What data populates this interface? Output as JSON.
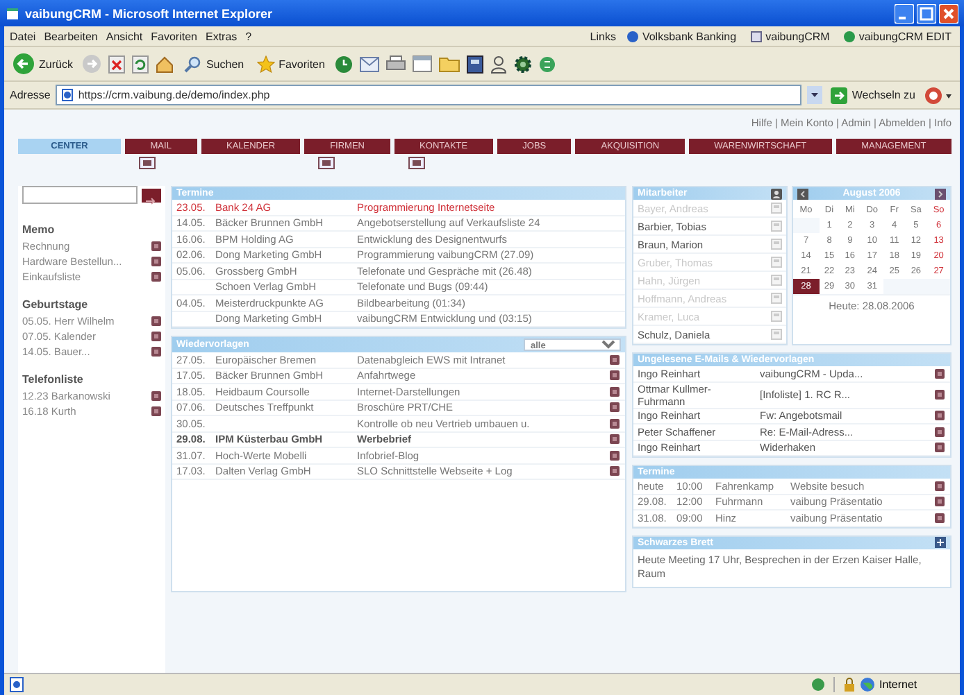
{
  "window": {
    "title": "vaibungCRM - Microsoft Internet Explorer"
  },
  "menu": [
    "Datei",
    "Bearbeiten",
    "Ansicht",
    "Favoriten",
    "Extras",
    "?"
  ],
  "links_bar": {
    "label": "Links",
    "items": [
      "Volksbank Banking",
      "vaibungCRM",
      "vaibungCRM EDIT"
    ]
  },
  "toolbar": {
    "back": "Zurück",
    "search": "Suchen",
    "favorites": "Favoriten"
  },
  "address_bar": {
    "label": "Adresse",
    "value": "https://crm.vaibung.de/demo/index.php",
    "go": "Wechseln zu"
  },
  "top_links": "Hilfe | Mein Konto | Admin | Abmelden | Info",
  "tabs": [
    {
      "label": "CENTER",
      "selected": true,
      "badge": false
    },
    {
      "label": "MAIL",
      "selected": false,
      "badge": true
    },
    {
      "label": "KALENDER",
      "selected": false,
      "badge": false
    },
    {
      "label": "FIRMEN",
      "selected": false,
      "badge": true
    },
    {
      "label": "KONTAKTE",
      "selected": false,
      "badge": true
    },
    {
      "label": "JOBS",
      "selected": false,
      "badge": false
    },
    {
      "label": "AKQUISITION",
      "selected": false,
      "badge": false
    },
    {
      "label": "WARENWIRTSCHAFT",
      "selected": false,
      "badge": false
    },
    {
      "label": "MANAGEMENT",
      "selected": false,
      "badge": false
    }
  ],
  "sidebar": {
    "sections": [
      {
        "title": "Memo",
        "items": [
          "Rechnung",
          "Hardware Bestellun...",
          "Einkaufsliste"
        ]
      },
      {
        "title": "Geburtstage",
        "items": [
          "05.05. Herr Wilhelm",
          "07.05. Kalender",
          "14.05. Bauer..."
        ]
      },
      {
        "title": "Telefonliste",
        "items": [
          "12.23 Barkanowski",
          "16.18 Kurth"
        ]
      }
    ]
  },
  "appointments": {
    "title": "Termine",
    "rows": [
      {
        "date": "23.05.",
        "company": "Bank 24 AG",
        "subject": "Programmierung Internetseite",
        "highlight": true
      },
      {
        "date": "14.05.",
        "company": "Bäcker Brunnen GmbH",
        "subject": "Angebotserstellung auf Verkaufsliste 24",
        "highlight": false
      },
      {
        "date": "16.06.",
        "company": "BPM Holding AG",
        "subject": "Entwicklung des Designentwurfs",
        "highlight": false
      },
      {
        "date": "02.06.",
        "company": "Dong Marketing GmbH",
        "subject": "Programmierung vaibungCRM (27.09)",
        "highlight": false
      },
      {
        "date": "05.06.",
        "company": "Grossberg GmbH",
        "subject": "Telefonate und Gespräche mit (26.48)",
        "highlight": false
      },
      {
        "company": "Schoen Verlag GmbH",
        "subject": "Telefonate und Bugs (09:44)",
        "highlight": false
      },
      {
        "date": "04.05.",
        "company": "Meisterdruckpunkte AG",
        "subject": "Bildbearbeitung (01:34)",
        "highlight": false
      },
      {
        "company": "Dong Marketing GmbH",
        "subject": "vaibungCRM Entwicklung und (03:15)",
        "highlight": false
      }
    ]
  },
  "followups": {
    "title": "Wiedervorlagen",
    "filter": "alle",
    "rows": [
      {
        "date": "27.05.",
        "company": "Europäischer Bremen",
        "subject": "Datenabgleich EWS mit Intranet",
        "bold": false
      },
      {
        "date": "17.05.",
        "company": "Bäcker Brunnen GmbH",
        "subject": "Anfahrtwege",
        "bold": false
      },
      {
        "date": "18.05.",
        "company": "Heidbaum Coursolle",
        "subject": "Internet-Darstellungen",
        "bold": false
      },
      {
        "date": "07.06.",
        "company": "Deutsches Treffpunkt",
        "subject": "Broschüre PRT/CHE",
        "bold": false
      },
      {
        "date": "30.05.",
        "subject": "Kontrolle ob neu Vertrieb umbauen u.",
        "bold": false
      },
      {
        "date": "29.08.",
        "company": "IPM Küsterbau GmbH",
        "subject": "Werbebrief",
        "bold": true
      },
      {
        "date": "31.07.",
        "company": "Hoch-Werte Mobelli",
        "subject": "Infobrief-Blog",
        "bold": false
      },
      {
        "date": "17.03.",
        "company": "Dalten Verlag GmbH",
        "subject": "SLO Schnittstelle Webseite + Log",
        "bold": false
      }
    ]
  },
  "staff": {
    "title": "Mitarbeiter",
    "rows": [
      {
        "name": "Bayer, Andreas",
        "present": false
      },
      {
        "name": "Barbier, Tobias",
        "present": true
      },
      {
        "name": "Braun, Marion",
        "present": true
      },
      {
        "name": "Gruber, Thomas",
        "present": false
      },
      {
        "name": "Hahn, Jürgen",
        "present": false
      },
      {
        "name": "Hoffmann, Andreas",
        "present": false
      },
      {
        "name": "Kramer, Luca",
        "present": false
      },
      {
        "name": "Schulz, Daniela",
        "present": true
      }
    ]
  },
  "calendar": {
    "title": "August 2006",
    "weekdays": [
      "Mo",
      "Di",
      "Mi",
      "Do",
      "Fr",
      "Sa",
      "So"
    ],
    "weeks": [
      [
        {
          "kind": "empty"
        },
        {
          "day": "1",
          "selected": false
        },
        {
          "day": "2",
          "selected": false
        },
        {
          "day": "3",
          "selected": false
        },
        {
          "day": "4",
          "selected": false
        },
        {
          "day": "5",
          "selected": false
        },
        {
          "day": "6",
          "selected": false
        }
      ],
      [
        {
          "day": "7",
          "selected": false
        },
        {
          "day": "8",
          "selected": false
        },
        {
          "day": "9",
          "selected": false
        },
        {
          "day": "10",
          "selected": false
        },
        {
          "day": "11",
          "selected": false
        },
        {
          "day": "12",
          "selected": false
        },
        {
          "day": "13",
          "selected": false
        }
      ],
      [
        {
          "day": "14",
          "selected": false
        },
        {
          "day": "15",
          "selected": false
        },
        {
          "day": "16",
          "selected": false
        },
        {
          "day": "17",
          "selected": false
        },
        {
          "day": "18",
          "selected": false
        },
        {
          "day": "19",
          "selected": false
        },
        {
          "day": "20",
          "selected": false
        }
      ],
      [
        {
          "day": "21",
          "selected": false
        },
        {
          "day": "22",
          "selected": false
        },
        {
          "day": "23",
          "selected": false
        },
        {
          "day": "24",
          "selected": false
        },
        {
          "day": "25",
          "selected": false
        },
        {
          "day": "26",
          "selected": false
        },
        {
          "day": "27",
          "selected": false
        }
      ],
      [
        {
          "day": "28",
          "selected": true
        },
        {
          "day": "29",
          "selected": false
        },
        {
          "day": "30",
          "selected": false
        },
        {
          "day": "31",
          "selected": false
        },
        {
          "kind": "empty"
        },
        {
          "kind": "empty"
        },
        {
          "kind": "empty"
        }
      ]
    ],
    "today_label": "Heute: 28.08.2006"
  },
  "emails": {
    "title": "Ungelesene E-Mails & Wiedervorlagen",
    "rows": [
      {
        "from": "Ingo Reinhart",
        "subject": "vaibungCRM - Upda..."
      },
      {
        "from": "Ottmar Kullmer-Fuhrmann",
        "subject": "[Infoliste] 1. RC R..."
      },
      {
        "from": "Ingo Reinhart",
        "subject": "Fw: Angebotsmail"
      },
      {
        "from": "Peter Schaffener",
        "subject": "Re: E-Mail-Adress..."
      },
      {
        "from": "Ingo Reinhart",
        "subject": "Widerhaken"
      }
    ]
  },
  "tasks": {
    "title": "Termine",
    "rows": [
      {
        "date": "heute",
        "time": "10:00",
        "name": "Fahrenkamp",
        "subject": "Website besuch"
      },
      {
        "date": "29.08.",
        "time": "12:00",
        "name": "Fuhrmann",
        "subject": "vaibung Präsentatio"
      },
      {
        "date": "31.08.",
        "time": "09:00",
        "name": "Hinz",
        "subject": "vaibung Präsentatio"
      }
    ]
  },
  "board": {
    "title": "Schwarzes Brett",
    "text": "Heute Meeting 17 Uhr, Besprechen in der Erzen Kaiser Halle, Raum"
  },
  "status_bar": {
    "zone": "Internet"
  }
}
